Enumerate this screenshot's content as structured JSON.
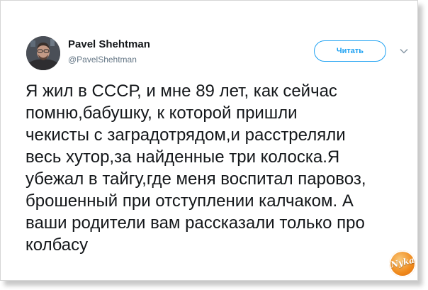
{
  "tweet": {
    "author_name": "Pavel Shehtman",
    "author_handle": "@PavelShehtman",
    "follow_label": "Читать",
    "text_lines": [
      "Я жил в СССР, и мне 89 лет, как сейчас",
      "помню,бабушку, к которой пришли",
      "чекисты с заградотрядом,и расстреляли",
      "весь хутор,за найденные три колоска.Я",
      "убежал в тайгу,где меня воспитал паровоз,",
      "брошенный при отступлении калчаком. А",
      "ваши родители вам рассказали только про",
      "колбасу"
    ]
  },
  "watermark": {
    "text": "Nyka",
    "icon": "brand-logo-badge"
  },
  "colors": {
    "accent": "#1da1f2",
    "text": "#14171a",
    "muted": "#657786",
    "badge": "#f08a1c"
  }
}
